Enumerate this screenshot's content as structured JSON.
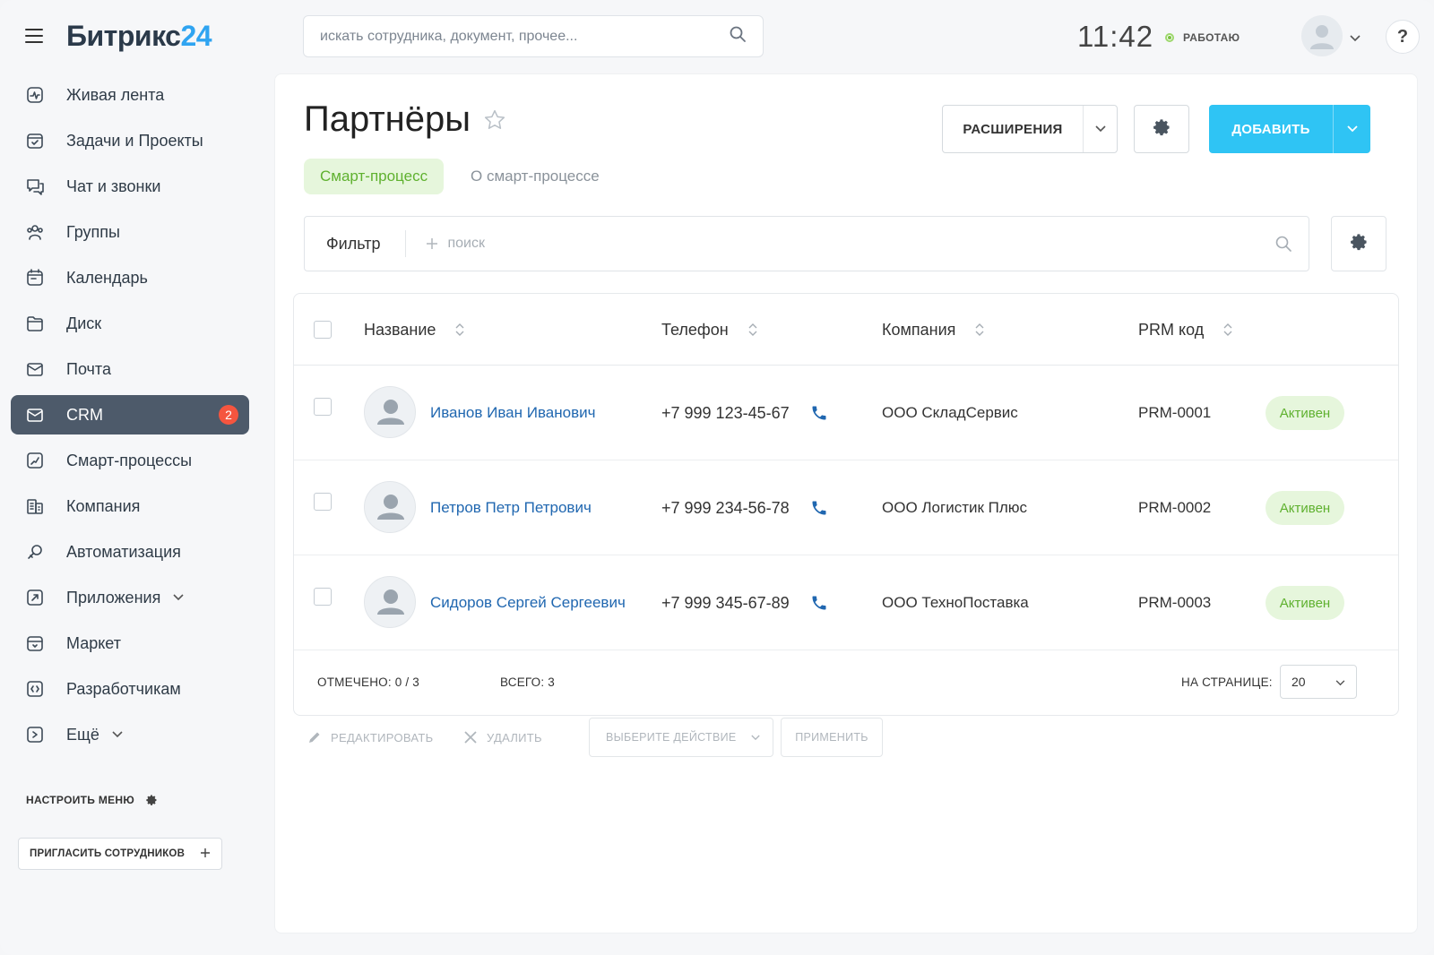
{
  "header": {
    "logo_main": "Битрикс",
    "logo_num": "24",
    "search_placeholder": "искать сотрудника, документ, прочее...",
    "time": "11:42",
    "status": "РАБОТАЮ",
    "help": "?"
  },
  "sidebar": {
    "items": [
      {
        "label": "Живая лента",
        "icon": "pulse-icon"
      },
      {
        "label": "Задачи и Проекты",
        "icon": "tasks-icon"
      },
      {
        "label": "Чат и звонки",
        "icon": "chat-icon"
      },
      {
        "label": "Группы",
        "icon": "groups-icon"
      },
      {
        "label": "Календарь",
        "icon": "calendar-icon"
      },
      {
        "label": "Диск",
        "icon": "folder-icon"
      },
      {
        "label": "Почта",
        "icon": "mail-icon"
      },
      {
        "label": "CRM",
        "icon": "crm-icon",
        "badge": "2",
        "active": true
      },
      {
        "label": "Смарт-процессы",
        "icon": "smart-process-icon"
      },
      {
        "label": "Компания",
        "icon": "company-icon"
      },
      {
        "label": "Автоматизация",
        "icon": "automation-icon"
      },
      {
        "label": "Приложения",
        "icon": "apps-icon",
        "expandable": true
      },
      {
        "label": "Маркет",
        "icon": "market-icon"
      },
      {
        "label": "Разработчикам",
        "icon": "developers-icon"
      },
      {
        "label": "Ещё",
        "icon": "more-icon",
        "expandable": true
      }
    ],
    "config_menu": "НАСТРОИТЬ МЕНЮ",
    "invite": "ПРИГЛАСИТЬ СОТРУДНИКОВ"
  },
  "page": {
    "title": "Партнёры",
    "tab_active": "Смарт-процесс",
    "tab_inactive": "О смарт-процессе",
    "ext_button": "РАСШИРЕНИЯ",
    "add_button": "ДОБАВИТЬ",
    "filter_label": "Фильтр",
    "filter_placeholder": "поиск"
  },
  "table": {
    "columns": [
      "Название",
      "Телефон",
      "Компания",
      "PRM код"
    ],
    "rows": [
      {
        "name": "Иванов Иван Иванович",
        "phone": "+7 999 123-45-67",
        "company": "ООО СкладСервис",
        "code": "PRM-0001",
        "status": "Активен"
      },
      {
        "name": "Петров Петр Петрович",
        "phone": "+7 999 234-56-78",
        "company": "ООО Логистик Плюс",
        "code": "PRM-0002",
        "status": "Активен"
      },
      {
        "name": "Сидоров Сергей Сергеевич",
        "phone": "+7 999 345-67-89",
        "company": "ООО ТехноПоставка",
        "code": "PRM-0003",
        "status": "Активен"
      }
    ],
    "selected": "ОТМЕЧЕНО: 0 / 3",
    "total": "ВСЕГО: 3",
    "per_page_label": "НА СТРАНИЦЕ:",
    "per_page_value": "20"
  },
  "actions": {
    "edit": "РЕДАКТИРОВАТЬ",
    "delete": "УДАЛИТЬ",
    "select_action": "ВЫБЕРИТЕ ДЕЙСТВИЕ",
    "apply": "ПРИМЕНИТЬ"
  },
  "colors": {
    "accent": "#2fc4f4",
    "active_nav": "#4d5a6a",
    "link": "#2067b0",
    "success_bg": "#e6f6dc",
    "success_text": "#5fb12f",
    "badge": "#f5553f"
  }
}
